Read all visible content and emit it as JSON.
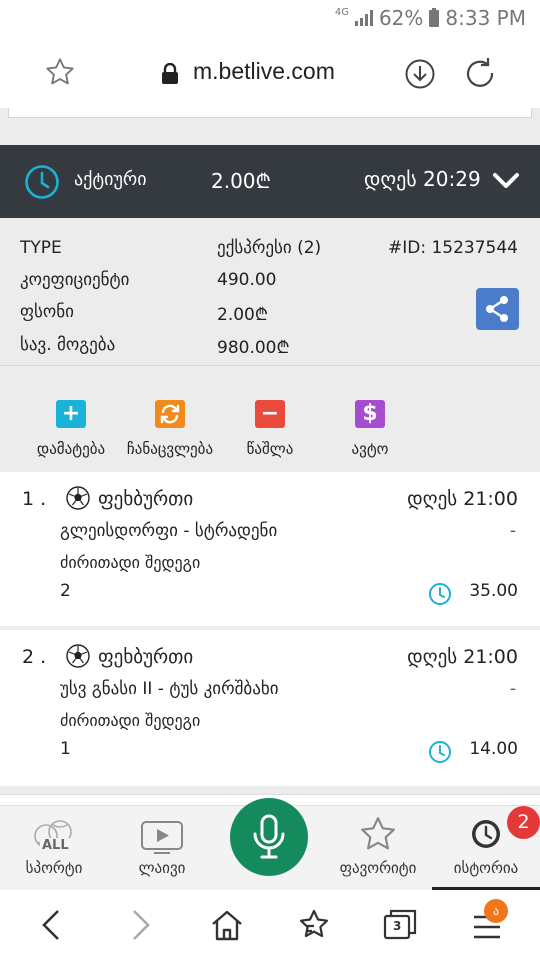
{
  "status_bar": {
    "network": "4G",
    "battery": "62%",
    "time": "8:33 PM"
  },
  "browser": {
    "url": "m.betlive.com"
  },
  "bet_header": {
    "status": "აქტიური",
    "amount": "2.00₾",
    "time": "დღეს 20:29"
  },
  "bet_details": {
    "rows": [
      {
        "label": "TYPE",
        "value": "ექსპრესი (2)"
      },
      {
        "label": "კოეფიციენტი",
        "value": "490.00"
      },
      {
        "label": "ფსონი",
        "value": "2.00₾"
      },
      {
        "label": "სავ. მოგება",
        "value": "980.00₾"
      }
    ],
    "id": "#ID: 15237544"
  },
  "actions": [
    {
      "label": "დამატება",
      "icon": "plus-icon",
      "color": "#1ab2d6"
    },
    {
      "label": "ჩანაცვლება",
      "icon": "swap-icon",
      "color": "#f08a1d"
    },
    {
      "label": "წაშლა",
      "icon": "minus-icon",
      "color": "#e94a3c"
    },
    {
      "label": "ავტო",
      "icon": "dollar-icon",
      "color": "#a54ccf"
    }
  ],
  "matches": [
    {
      "num": "1 .",
      "sport": "ფეხბურთი",
      "time": "დღეს 21:00",
      "teams": "გლეისდორფი - სტრადენი",
      "dash": "-",
      "market": "ძირითადი შედეგი",
      "selection": "2",
      "odds": "35.00"
    },
    {
      "num": "2 .",
      "sport": "ფეხბურთი",
      "time": "დღეს 21:00",
      "teams": "უსვ გნასი II - ტუს კირშბახი",
      "dash": "-",
      "market": "ძირითადი შედეგი",
      "selection": "1",
      "odds": "14.00"
    }
  ],
  "app_nav": {
    "sport": "სპორტი",
    "sport_icon_text": "ALL",
    "live": "ლაივი",
    "favorites": "ფავორიტი",
    "history": "ისტორია",
    "history_badge": "2"
  },
  "browser_nav": {
    "tabs_count": "3",
    "menu_badge": "ა"
  },
  "colors": {
    "dark_bar": "#353a41",
    "accent_teal": "#1ab2d6",
    "mic_green": "#158a5d",
    "share_blue": "#4a7cc9",
    "badge_red": "#e53838"
  }
}
